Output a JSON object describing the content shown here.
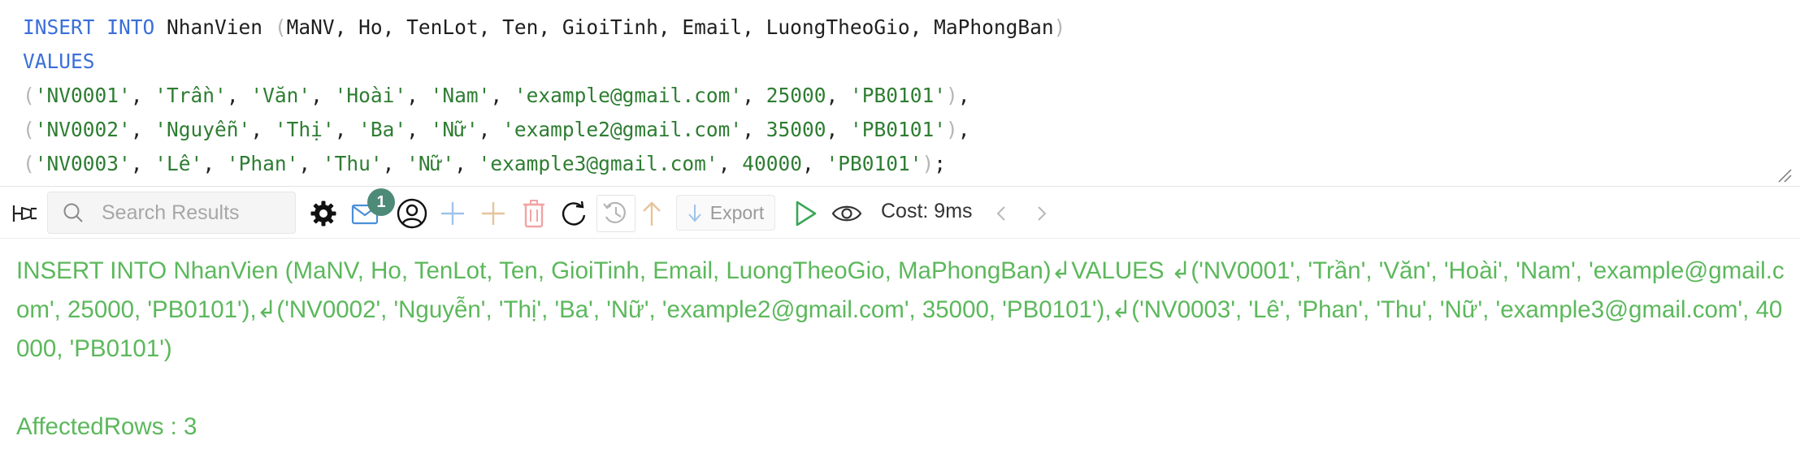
{
  "editor": {
    "line1": {
      "kw": "INSERT INTO",
      "table": "NhanVien",
      "open": "(",
      "columns": "MaNV, Ho, TenLot, Ten, GioiTinh, Email, LuongTheoGio, MaPhongBan",
      "close": ")"
    },
    "line2": {
      "kw": "VALUES"
    },
    "rows": [
      {
        "open": "(",
        "v1": "'NV0001'",
        "v2": "'Trần'",
        "v3": "'Văn'",
        "v4": "'Hoài'",
        "v5": "'Nam'",
        "v6": "'example@gmail.com'",
        "v7": "25000",
        "v8": "'PB0101'",
        "close": ")",
        "end": ","
      },
      {
        "open": "(",
        "v1": "'NV0002'",
        "v2": "'Nguyễn'",
        "v3": "'Thị'",
        "v4": "'Ba'",
        "v5": "'Nữ'",
        "v6": "'example2@gmail.com'",
        "v7": "35000",
        "v8": "'PB0101'",
        "close": ")",
        "end": ","
      },
      {
        "open": "(",
        "v1": "'NV0003'",
        "v2": "'Lê'",
        "v3": "'Phan'",
        "v4": "'Thu'",
        "v5": "'Nữ'",
        "v6": "'example3@gmail.com'",
        "v7": "40000",
        "v8": "'PB0101'",
        "close": ")",
        "end": ";"
      }
    ],
    "sep": ", "
  },
  "toolbar": {
    "search_placeholder": "Search Results",
    "notification_count": "1",
    "export_label": "Export",
    "cost_label": "Cost: 9ms",
    "icons": [
      "pin-icon",
      "search-icon",
      "gear-icon",
      "mail-icon",
      "user-icon",
      "add-icon",
      "add-row-icon",
      "delete-icon",
      "refresh-icon",
      "history-icon",
      "up-arrow-icon",
      "download-icon",
      "run-icon",
      "eye-icon",
      "chevron-left-icon",
      "chevron-right-icon"
    ]
  },
  "result": {
    "executed_sql": "INSERT INTO NhanVien (MaNV, Ho, TenLot, Ten, GioiTinh, Email, LuongTheoGio, MaPhongBan)↲VALUES ↲('NV0001', 'Trần', 'Văn', 'Hoài', 'Nam', 'example@gmail.com', 25000, 'PB0101'),↲('NV0002', 'Nguyễn', 'Thị', 'Ba', 'Nữ', 'example2@gmail.com', 35000, 'PB0101'),↲('NV0003', 'Lê', 'Phan', 'Thu', 'Nữ', 'example3@gmail.com', 40000, 'PB0101')",
    "affected_rows": "AffectedRows : 3"
  },
  "colors": {
    "keyword": "#3a6fd8",
    "string": "#2e7d32",
    "result_text": "#5cb85c",
    "badge": "#4e8a78"
  }
}
